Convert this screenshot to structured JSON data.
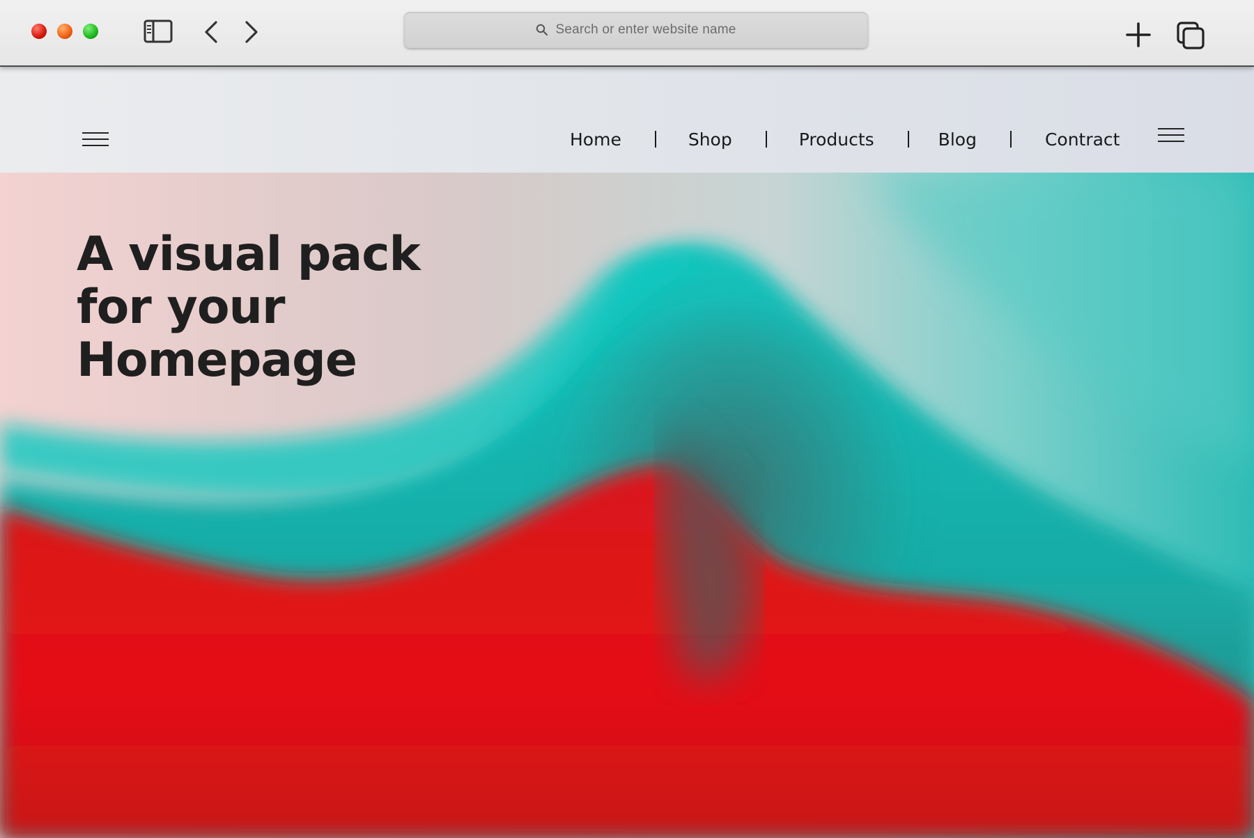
{
  "browser": {
    "address_bar": {
      "placeholder": "Search or enter website name"
    },
    "icons": {
      "sidebar_toggle": "sidebar-icon",
      "back": "chevron-left-icon",
      "forward": "chevron-right-icon",
      "search": "search-icon",
      "new_tab": "plus-icon",
      "tab_overview": "tabs-icon"
    },
    "traffic_lights": {
      "close": "#e0281a",
      "minimize": "#f2661a",
      "maximize": "#27c226"
    }
  },
  "site": {
    "nav": {
      "items": [
        {
          "label": "Home"
        },
        {
          "label": "Shop"
        },
        {
          "label": "Products"
        },
        {
          "label": "Blog"
        },
        {
          "label": "Contract"
        }
      ]
    },
    "hero": {
      "title_lines": [
        "A visual pack",
        "for your",
        "Homepage"
      ]
    },
    "colors": {
      "teal": "#19bdb8",
      "red": "#e3121a",
      "text": "#1f1f1f"
    }
  }
}
